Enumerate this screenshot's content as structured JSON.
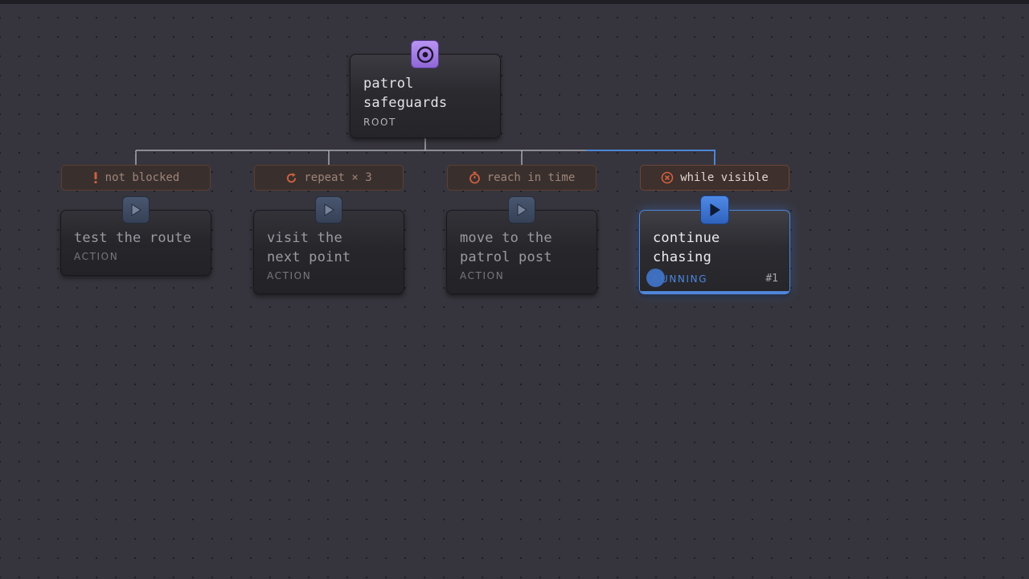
{
  "root": {
    "title_line1": "patrol",
    "title_line2": "safeguards",
    "type": "ROOT",
    "icon": "target-icon"
  },
  "children": [
    {
      "decorator": {
        "icon": "exclamation-icon",
        "label": "not blocked"
      },
      "title_line1": "test the route",
      "title_line2": "",
      "type": "ACTION",
      "icon": "play-icon"
    },
    {
      "decorator": {
        "icon": "repeat-icon",
        "label": "repeat × 3"
      },
      "title_line1": "visit the",
      "title_line2": "next point",
      "type": "ACTION",
      "icon": "play-icon"
    },
    {
      "decorator": {
        "icon": "timer-icon",
        "label": "reach in time"
      },
      "title_line1": "move to the",
      "title_line2": "patrol post",
      "type": "ACTION",
      "icon": "play-icon"
    },
    {
      "decorator": {
        "icon": "cancel-circle-icon",
        "label": "while visible"
      },
      "title_line1": "continue",
      "title_line2": "chasing",
      "type": "RUNNING",
      "exec_count": "#1",
      "icon": "play-icon",
      "progress": 1.0
    }
  ],
  "colors": {
    "active": "#4f86d8",
    "root_badge": "#a47ee6",
    "decorator_border": "#6e4534",
    "canvas": "#36353d"
  }
}
